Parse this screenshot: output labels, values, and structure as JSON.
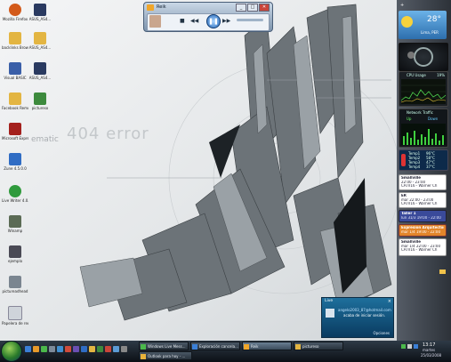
{
  "wallpaper": {
    "bg_text": "404 error",
    "brand_text": "ematic"
  },
  "desktop_icons": [
    {
      "label": "Mozilla Firefox",
      "color": "#d35a1b"
    },
    {
      "label": "ASUS_AS4...",
      "color": "#2a3a60"
    },
    {
      "label": "backlinks Brows...",
      "color": "#e3b542"
    },
    {
      "label": "ASUS_AS4...",
      "color": "#e3b542"
    },
    {
      "label": "Visual BASIC",
      "color": "#3a5fa8"
    },
    {
      "label": "ASUS_AS4...",
      "color": "#2a3a60"
    },
    {
      "label": "Facebook Remote Ad...",
      "color": "#e3b542"
    },
    {
      "label": "pictureso",
      "color": "#3d8a3d"
    },
    {
      "label": "Microsoft Expression...",
      "color": "#a4201d"
    },
    {
      "label": "Zune 4.5.0.0",
      "color": "#2f6cc4"
    },
    {
      "label": "Live Writer 4.0.2.0",
      "color": "#2f9a3c"
    },
    {
      "label": "Winamp",
      "color": "#5b6b55"
    },
    {
      "label": "ejemplo",
      "color": "#4a4a55"
    },
    {
      "label": "pictureadhead",
      "color": "#7a8590"
    },
    {
      "label": "Papelera de reciclaje",
      "color": "#cfd4da"
    }
  ],
  "media_player": {
    "title": "Reik",
    "controls": [
      "■",
      "◀◀",
      "▶▶"
    ],
    "play_symbol": "❚❚",
    "window_buttons": [
      "_",
      "□",
      "✕"
    ]
  },
  "sidebar": {
    "weather": {
      "temp": "28°",
      "location": "Lima, PER"
    },
    "cpu": {
      "label": "CPU Usage",
      "value": "19%"
    },
    "network": {
      "label": "Network Traffic",
      "up": "Up",
      "down": "Down"
    },
    "temps": [
      {
        "a": "Temp1",
        "b": "96°C"
      },
      {
        "a": "Temp2",
        "b": "58°C"
      },
      {
        "a": "Temp3",
        "b": "47°C"
      },
      {
        "a": "Temp4",
        "b": "37°C"
      }
    ],
    "calendar": [
      {
        "title": "Smallville",
        "time": "22:00 - 23:00",
        "sub": "CATV16 - Warner Ch"
      },
      {
        "title": "ER",
        "time": "mar 22:00 - 23:00",
        "sub": "CATV16 - Warner Ch"
      },
      {
        "title": "Taller 1",
        "time": "lun 31/3 19:00 - 22:00"
      },
      {
        "title": "Expresion Arquitectonica",
        "time": "mar 1/4 19:00 - 22:00"
      },
      {
        "title": "Smallville",
        "time": "mar 1/4 22:00 - 23:00",
        "sub": "CATV16 - Warner Ch"
      }
    ],
    "colors": {
      "expresion": "#e2852a",
      "taller": "#3a4a9a"
    }
  },
  "toast": {
    "title": "Live",
    "email": "angelo2003_87@hotmail.com",
    "message": "acaba de iniciar sesión.",
    "options": "Opciones"
  },
  "taskbar": {
    "tasks": [
      {
        "label": "Windows Live Mess..."
      },
      {
        "label": "Exploración cancela..."
      },
      {
        "label": "Reik"
      },
      {
        "label": "pictureso"
      },
      {
        "label": "Outlook para hoy - ..."
      }
    ],
    "clock": {
      "time": "13:17",
      "day": "martes",
      "date": "25/03/2008"
    }
  }
}
